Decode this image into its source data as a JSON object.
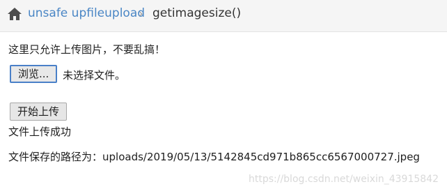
{
  "breadcrumb": {
    "home_icon": "home-icon",
    "link_label": "unsafe upfileupload",
    "separator": "›",
    "current_label": "getimagesize()"
  },
  "main": {
    "notice": "这里只允许上传图片，不要乱搞！",
    "browse_button_label": "浏览...",
    "file_status": "未选择文件。",
    "upload_button_label": "开始上传",
    "success_message": "文件上传成功",
    "saved_path": "文件保存的路径为：uploads/2019/05/13/5142845cd971b865cc6567000727.jpeg"
  },
  "watermark": "https://blog.csdn.net/weixin_43915842",
  "colors": {
    "link": "#4a86c5",
    "breadcrumb_bg": "#f5f5f5",
    "focus_border": "#4a80c8"
  }
}
